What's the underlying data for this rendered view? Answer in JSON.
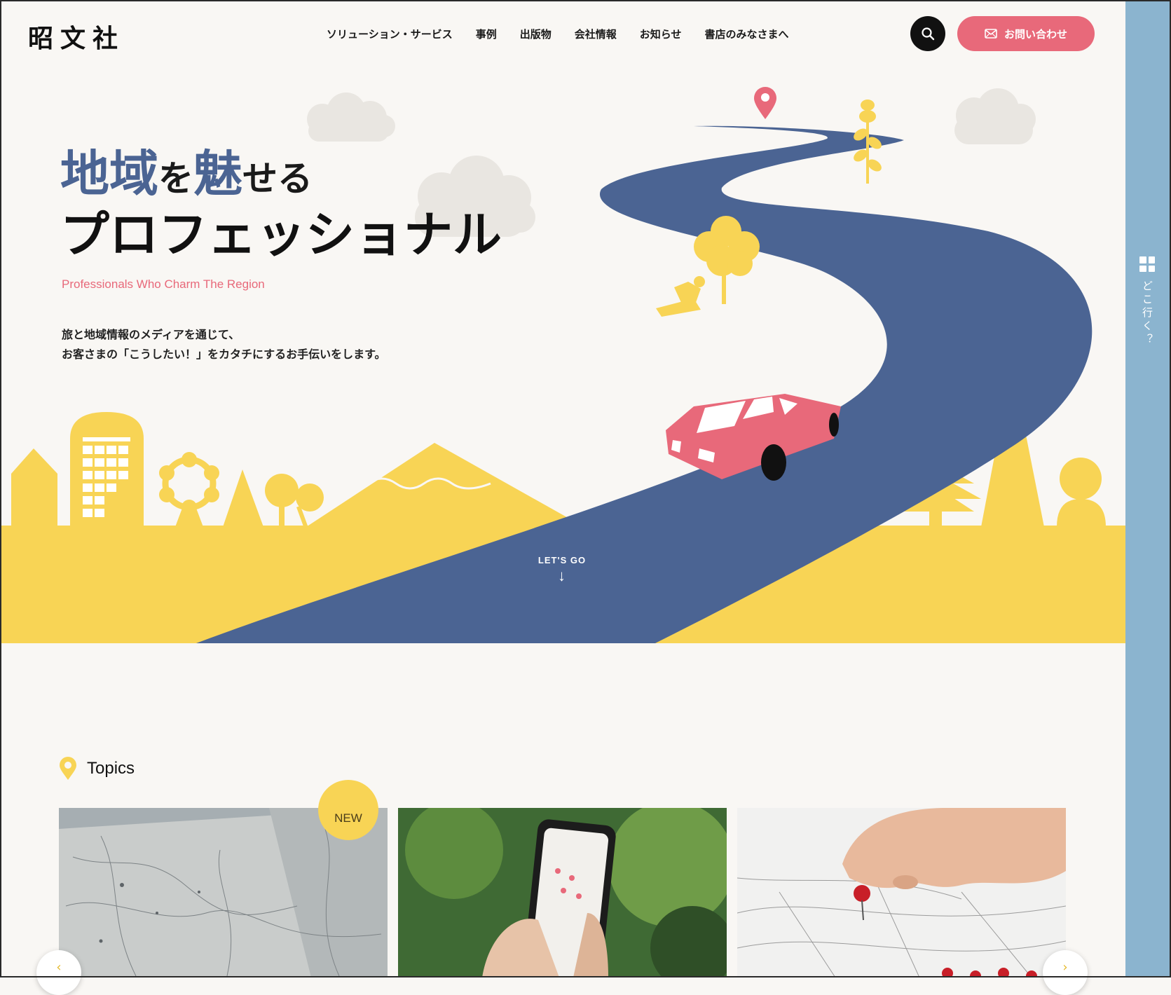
{
  "header": {
    "logo": "昭文社",
    "nav": [
      "ソリューション・サービス",
      "事例",
      "出版物",
      "会社情報",
      "お知らせ",
      "書店のみなさまへ"
    ],
    "contact_label": "お問い合わせ"
  },
  "side_panel": {
    "label": "どこ行く？"
  },
  "hero": {
    "headline_part1": "地域",
    "headline_part2": "を",
    "headline_part3": "魅",
    "headline_part4": "せる",
    "headline_line2": "プロフェッショナル",
    "subtitle": "Professionals Who Charm The Region",
    "description_line1": "旅と地域情報のメディアを通じて、",
    "description_line2": "お客さまの「こうしたい！」をカタチにするお手伝いをします。",
    "scroll_label": "LET'S GO"
  },
  "topics": {
    "title": "Topics",
    "new_badge": "NEW"
  },
  "colors": {
    "accent_pink": "#e8697a",
    "road_blue": "#4b6493",
    "yellow": "#f8d455",
    "side_blue": "#8bb4cf"
  }
}
